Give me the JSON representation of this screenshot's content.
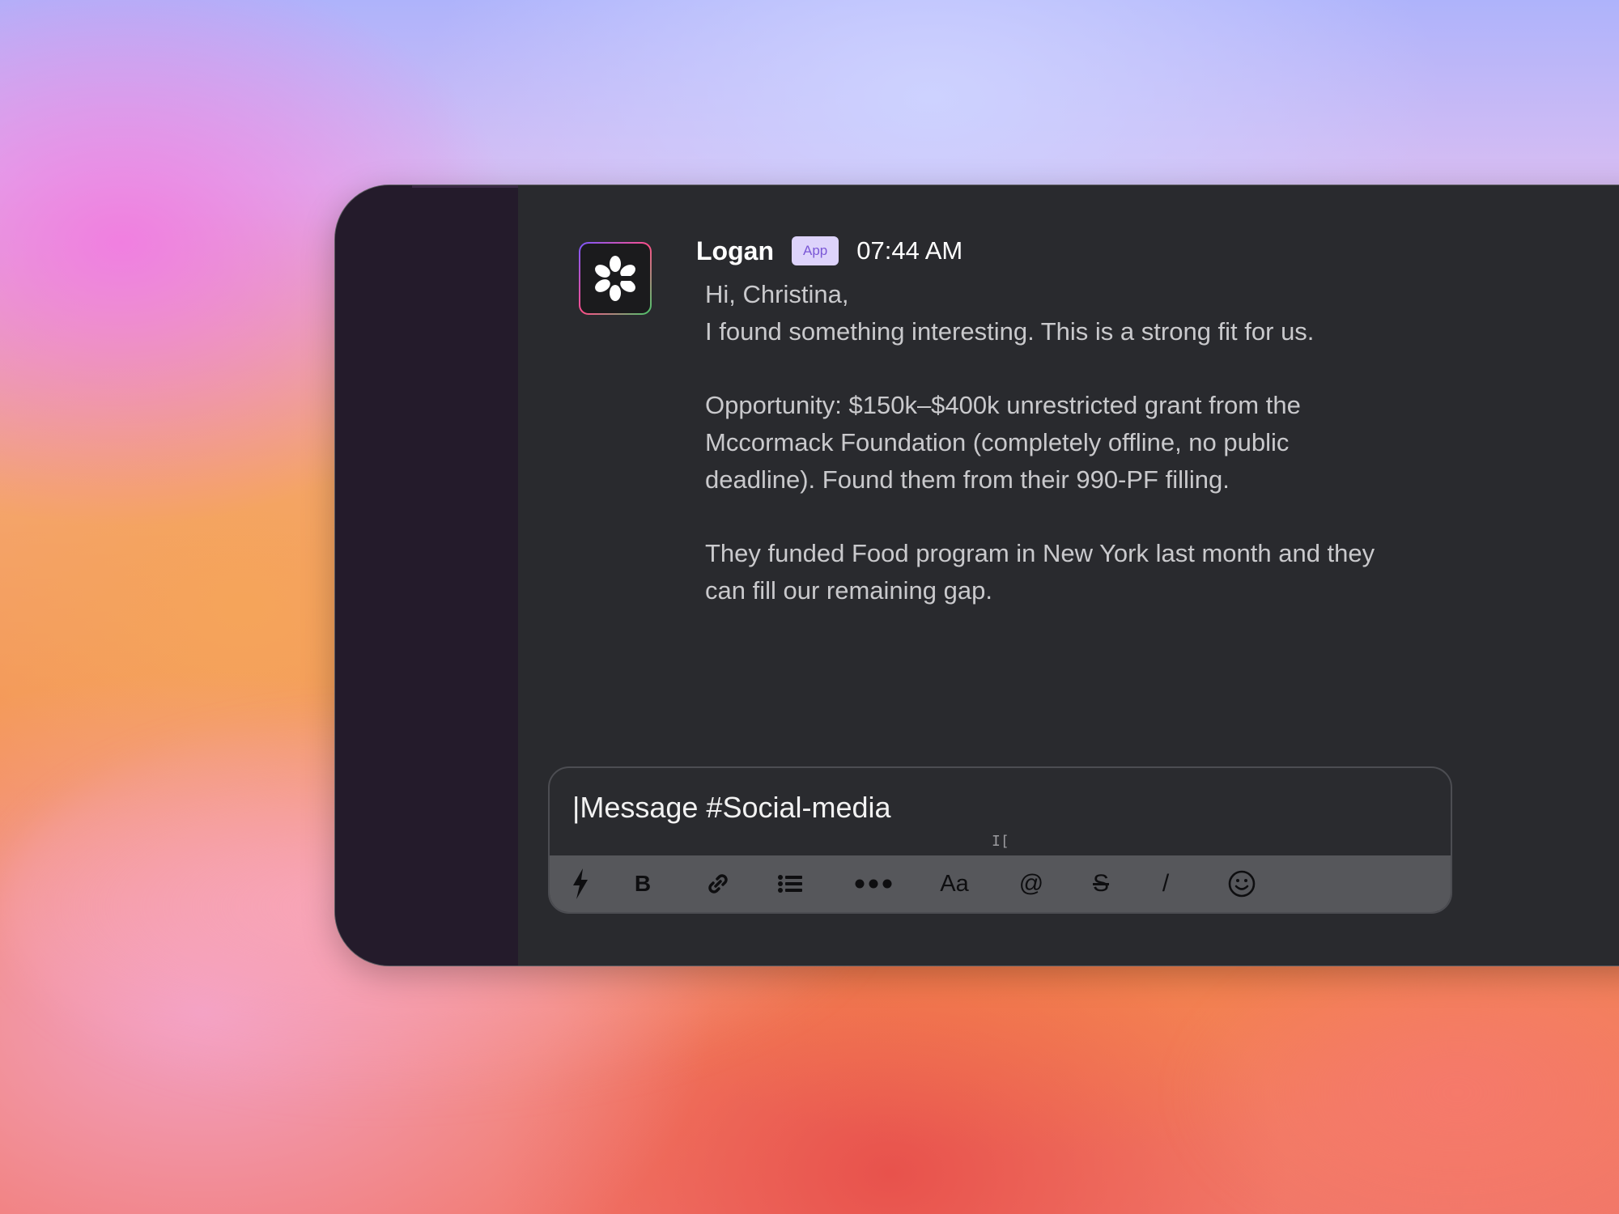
{
  "message": {
    "author": "Logan",
    "badge": "App",
    "time": "07:44 AM",
    "lines": [
      "Hi, Christina,",
      "I found something interesting. This is a strong fit for us.",
      "",
      "Opportunity: $150k–$400k unrestricted grant from the",
      "Mccormack Foundation (completely offline, no public",
      "deadline). Found them from their 990-PF filling.",
      "",
      "They funded Food program in New York last month and they",
      "can fill our remaining gap."
    ]
  },
  "composer": {
    "value": "|Message #Social-media",
    "cursor_glyph": "I[",
    "toolbar": [
      {
        "name": "shortcut-bolt-icon",
        "label": ""
      },
      {
        "name": "bold-button",
        "label": "B"
      },
      {
        "name": "link-icon",
        "label": ""
      },
      {
        "name": "bulleted-list-icon",
        "label": ""
      },
      {
        "name": "more-icon",
        "label": ""
      },
      {
        "name": "text-format-button",
        "label": "Aa"
      },
      {
        "name": "mention-button",
        "label": "@"
      },
      {
        "name": "strikethrough-button",
        "label": "S"
      },
      {
        "name": "slash-command-button",
        "label": "/"
      },
      {
        "name": "emoji-icon",
        "label": ""
      }
    ]
  },
  "colors": {
    "sidebar": "#241b2b",
    "main": "#292a2e",
    "toolbar": "#56575b",
    "badge_bg": "#ddd3fb",
    "badge_text": "#7a57d6"
  }
}
